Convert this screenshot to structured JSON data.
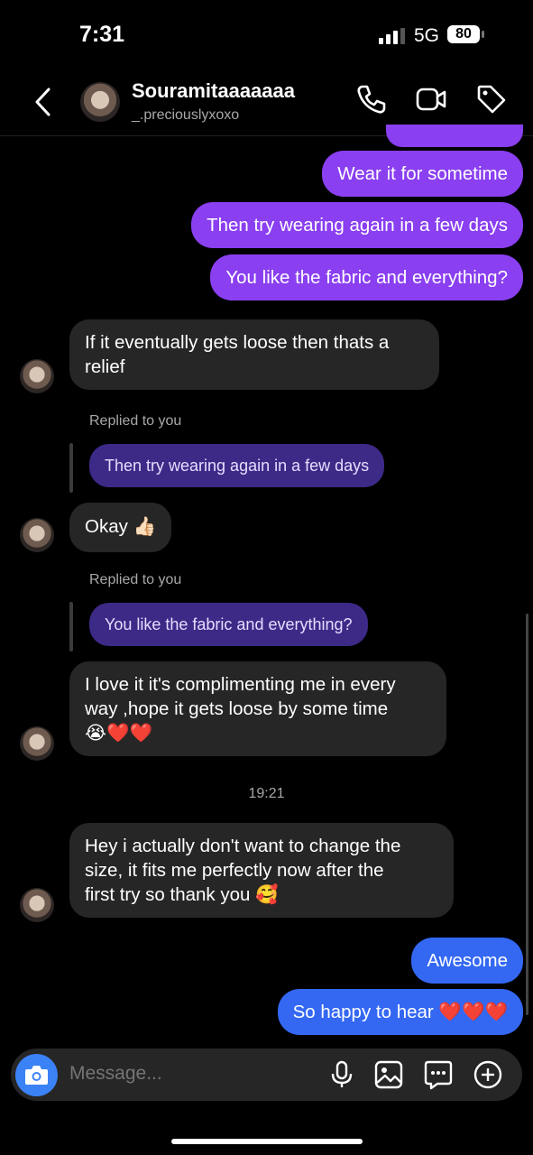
{
  "status_bar": {
    "time": "7:31",
    "network": "5G",
    "battery": "80"
  },
  "header": {
    "name": "Souramitaaaaaaa",
    "username": "_.preciouslyxoxo",
    "icons": [
      "back-icon",
      "phone-icon",
      "video-icon",
      "tag-icon"
    ]
  },
  "messages": {
    "m1": "Wear it for sometime",
    "m2": "Then try wearing again in a few days",
    "m3": "You like the fabric and everything?",
    "m4_line1": "If it eventually gets loose then thats a",
    "m4_line2": "relief",
    "reply1_label": "Replied to you",
    "reply1_quote": "Then try wearing again in a few days",
    "m5": "Okay 👍🏻",
    "reply2_label": "Replied to you",
    "reply2_quote": "You like the fabric and everything?",
    "m6_line1": "I love it it's complimenting me in every",
    "m6_line2": "way ,hope it gets loose by some time",
    "m6_line3": "😭❤️❤️",
    "timestamp": "19:21",
    "m7_line1": "Hey i actually don't want to change the",
    "m7_line2": "size, it fits me perfectly now after the",
    "m7_line3": "first try so thank you 🥰",
    "m8": "Awesome",
    "m9": "So happy to hear ❤️❤️❤️"
  },
  "composer": {
    "placeholder": "Message...",
    "icons": [
      "camera-icon",
      "microphone-icon",
      "gallery-icon",
      "sticker-icon",
      "add-icon"
    ]
  },
  "colors": {
    "outgoing_purple": "#8a3ff0",
    "outgoing_blue": "#3468f3",
    "incoming": "#262626",
    "reply_quote": "#3d2a87"
  }
}
